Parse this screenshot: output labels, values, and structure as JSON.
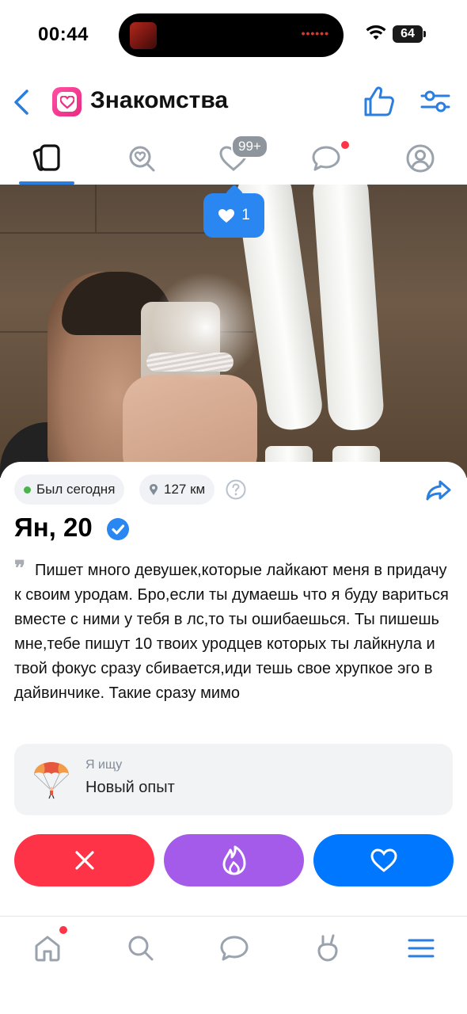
{
  "status_bar": {
    "time": "00:44",
    "battery": "64",
    "island_indicator": "••••••"
  },
  "header": {
    "title": "Знакомства",
    "back_icon": "chevron-left-icon",
    "logo_icon": "heart-app-icon",
    "right_icons": [
      "thumbs-up-icon",
      "filter-icon"
    ]
  },
  "tabs": {
    "items": [
      "cards-icon",
      "search-heart-icon",
      "heart-icon",
      "chat-icon",
      "profile-icon"
    ],
    "likes_badge": "99+",
    "active_index": 0
  },
  "photo": {
    "likes_count": "1",
    "expand_icon": "chevron-down-icon"
  },
  "profile": {
    "last_seen": "Был сегодня",
    "distance": "127 км",
    "name": "Ян, 20",
    "bio": "Пишет много девушек,которые лайкают меня в придачу к своим уродам. Бро,если ты думаешь что я буду вариться вместе с ними у тебя в лс,то ты ошибаешься. Ты пишешь мне,тебе пишут 10 твоих уродцев которых ты лайкнула и твой фокус сразу сбивается,иди тешь свое хрупкое эго в дайвинчике. Такие сразу мимо",
    "seeking_label": "Я ищу",
    "seeking_value": "Новый опыт"
  },
  "actions": [
    "close-icon",
    "flame-icon",
    "heart-icon"
  ],
  "bottom_nav": [
    "home-icon",
    "search-icon",
    "chat-icon",
    "clips-icon",
    "menu-icon"
  ],
  "colors": {
    "accent": "#0077ff",
    "dislike": "#ff3347",
    "super": "#a55bea",
    "online": "#4bb34b"
  }
}
